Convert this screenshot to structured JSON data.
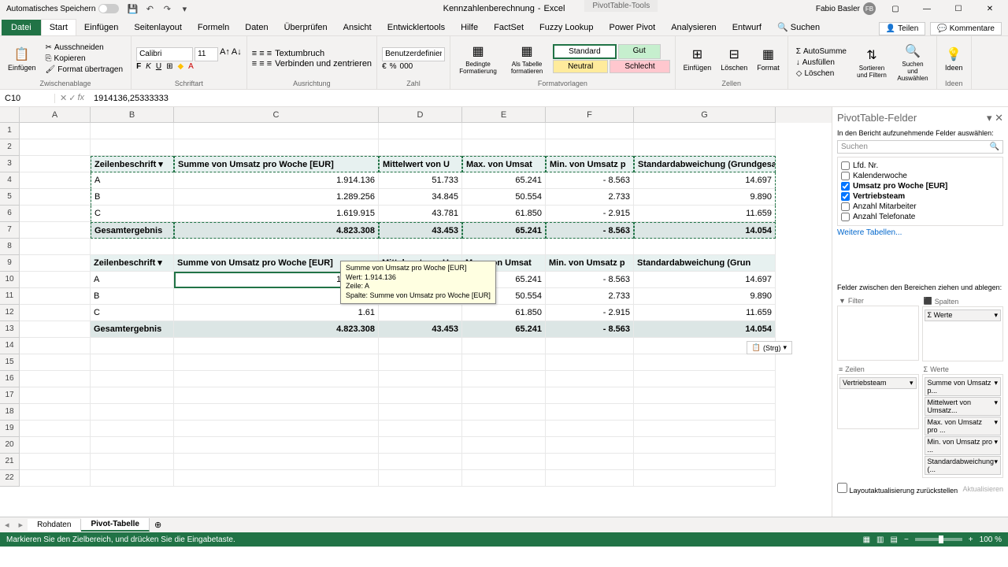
{
  "titlebar": {
    "autosave": "Automatisches Speichern",
    "filename": "Kennzahlenberechnung",
    "app": "Excel",
    "tools": "PivotTable-Tools",
    "user": "Fabio Basler",
    "initials": "FB"
  },
  "tabs": {
    "file": "Datei",
    "items": [
      "Start",
      "Einfügen",
      "Seitenlayout",
      "Formeln",
      "Daten",
      "Überprüfen",
      "Ansicht",
      "Entwicklertools",
      "Hilfe",
      "FactSet",
      "Fuzzy Lookup",
      "Power Pivot",
      "Analysieren",
      "Entwurf"
    ],
    "search": "Suchen",
    "share": "Teilen",
    "comments": "Kommentare"
  },
  "ribbon": {
    "clipboard": {
      "paste": "Einfügen",
      "cut": "Ausschneiden",
      "copy": "Kopieren",
      "painter": "Format übertragen",
      "label": "Zwischenablage"
    },
    "font": {
      "name": "Calibri",
      "size": "11",
      "label": "Schriftart"
    },
    "align": {
      "wrap": "Textumbruch",
      "merge": "Verbinden und zentrieren",
      "label": "Ausrichtung"
    },
    "number": {
      "format": "Benutzerdefiniert",
      "label": "Zahl"
    },
    "styles": {
      "cond": "Bedingte Formatierung",
      "table": "Als Tabelle formatieren",
      "standard": "Standard",
      "gut": "Gut",
      "neutral": "Neutral",
      "schlecht": "Schlecht",
      "label": "Formatvorlagen"
    },
    "cells": {
      "insert": "Einfügen",
      "delete": "Löschen",
      "format": "Format",
      "label": "Zellen"
    },
    "editing": {
      "sum": "AutoSumme",
      "fill": "Ausfüllen",
      "clear": "Löschen",
      "sort": "Sortieren und Filtern",
      "find": "Suchen und Auswählen",
      "label": ""
    },
    "ideas": {
      "label": "Ideen"
    }
  },
  "formula": {
    "cell": "C10",
    "value": "1914136,25333333"
  },
  "cols": [
    "A",
    "B",
    "C",
    "D",
    "E",
    "F",
    "G"
  ],
  "header_row_labels": "Zeilenbeschrift",
  "headers": [
    "Summe von Umsatz pro Woche [EUR]",
    "Mittelwert von U",
    "Max. von Umsat",
    "Min. von Umsatz p",
    "Standardabweichung (Grundgesam"
  ],
  "headers2_last": "Standardabweichung (Grun",
  "data": [
    {
      "label": "A",
      "c": "1.914.136",
      "d": "51.733",
      "e": "65.241",
      "f": "-          8.563",
      "g": "14.697"
    },
    {
      "label": "B",
      "c": "1.289.256",
      "d": "34.845",
      "e": "50.554",
      "f": "2.733",
      "g": "9.890"
    },
    {
      "label": "C",
      "c": "1.619.915",
      "d": "43.781",
      "e": "61.850",
      "f": "-          2.915",
      "g": "11.659"
    }
  ],
  "total": {
    "label": "Gesamtergebnis",
    "c": "4.823.308",
    "d": "43.453",
    "e": "65.241",
    "f": "-          8.563",
    "g": "14.054"
  },
  "data2": [
    {
      "label": "A",
      "c": "1.914.136",
      "d": "51.733",
      "e": "65.241",
      "f": "-          8.563",
      "g": "14.697"
    },
    {
      "label": "B",
      "c": "1.28",
      "d": "",
      "e": "50.554",
      "f": "2.733",
      "g": "9.890"
    },
    {
      "label": "C",
      "c": "1.61",
      "d": "",
      "e": "61.850",
      "f": "-          2.915",
      "g": "11.659"
    }
  ],
  "tooltip": {
    "l1": "Summe von Umsatz pro Woche [EUR]",
    "l2": "Wert: 1.914.136",
    "l3": "Zeile: A",
    "l4": "Spalte: Summe von Umsatz pro Woche [EUR]"
  },
  "paste_opts": "(Strg)",
  "fieldpane": {
    "title": "PivotTable-Felder",
    "subtitle": "In den Bericht aufzunehmende Felder auswählen:",
    "search": "Suchen",
    "fields": [
      {
        "name": "Lfd. Nr.",
        "checked": false
      },
      {
        "name": "Kalenderwoche",
        "checked": false
      },
      {
        "name": "Umsatz pro Woche [EUR]",
        "checked": true,
        "bold": true
      },
      {
        "name": "Vertriebsteam",
        "checked": true,
        "bold": true
      },
      {
        "name": "Anzahl Mitarbeiter",
        "checked": false
      },
      {
        "name": "Anzahl Telefonate",
        "checked": false
      }
    ],
    "more": "Weitere Tabellen...",
    "drag": "Felder zwischen den Bereichen ziehen und ablegen:",
    "filter": "Filter",
    "columns": "Spalten",
    "columns_item": "Σ Werte",
    "rows": "Zeilen",
    "rows_item": "Vertriebsteam",
    "values": "Werte",
    "values_items": [
      "Summe von Umsatz p...",
      "Mittelwert von Umsatz...",
      "Max. von Umsatz pro ...",
      "Min. von Umsatz pro ...",
      "Standardabweichung (..."
    ],
    "defer": "Layoutaktualisierung zurückstellen",
    "update": "Aktualisieren"
  },
  "sheets": {
    "tab1": "Rohdaten",
    "tab2": "Pivot-Tabelle"
  },
  "status": {
    "msg": "Markieren Sie den Zielbereich, und drücken Sie die Eingabetaste.",
    "zoom": "100 %"
  }
}
